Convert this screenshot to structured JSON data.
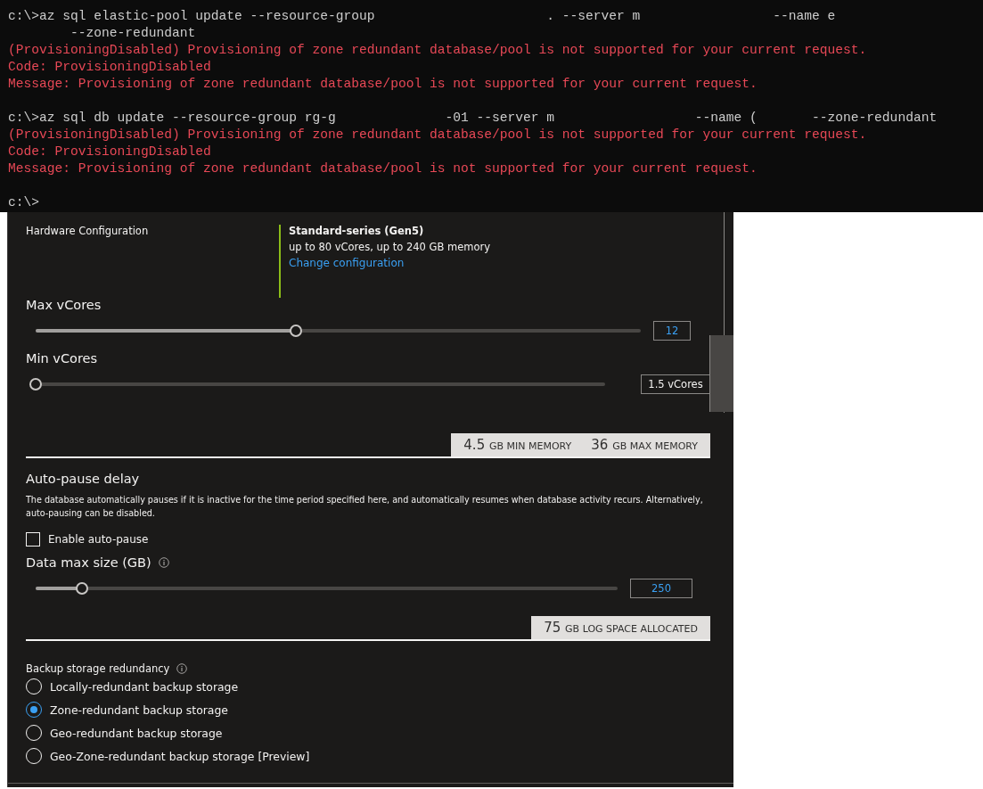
{
  "terminal": {
    "lines": [
      {
        "kind": "command",
        "text": "c:\\>az sql elastic-pool update --resource-group                      . --server m                 --name e"
      },
      {
        "kind": "command",
        "text": "        --zone-redundant"
      },
      {
        "kind": "error",
        "text": "(ProvisioningDisabled) Provisioning of zone redundant database/pool is not supported for your current request."
      },
      {
        "kind": "error",
        "text": "Code: ProvisioningDisabled"
      },
      {
        "kind": "error",
        "text": "Message: Provisioning of zone redundant database/pool is not supported for your current request."
      },
      {
        "kind": "blank"
      },
      {
        "kind": "command",
        "text": "c:\\>az sql db update --resource-group rg-g              -01 --server m                  --name (       --zone-redundant"
      },
      {
        "kind": "error",
        "text": "(ProvisioningDisabled) Provisioning of zone redundant database/pool is not supported for your current request."
      },
      {
        "kind": "error",
        "text": "Code: ProvisioningDisabled"
      },
      {
        "kind": "error",
        "text": "Message: Provisioning of zone redundant database/pool is not supported for your current request."
      },
      {
        "kind": "blank"
      },
      {
        "kind": "command",
        "text": "c:\\>"
      }
    ]
  },
  "hardware": {
    "label": "Hardware Configuration",
    "series": "Standard-series (Gen5)",
    "details": "up to 80 vCores, up to 240 GB memory",
    "link": "Change configuration"
  },
  "max_vcores": {
    "label": "Max vCores",
    "level": 0.43,
    "value": "12"
  },
  "min_vcores": {
    "label": "Min vCores",
    "level": 0,
    "value": "1.5 vCores"
  },
  "memory": [
    {
      "amount": "4.5",
      "unit": "GB MIN MEMORY"
    },
    {
      "amount": "36",
      "unit": "GB MAX MEMORY"
    }
  ],
  "auto_pause": {
    "title": "Auto-pause delay",
    "description": "The database automatically pauses if it is inactive for the time period specified here, and automatically resumes when database activity recurs. Alternatively, auto-pausing can be disabled.",
    "checkbox": {
      "label": "Enable auto-pause",
      "checked": false
    }
  },
  "data_max_size": {
    "label": "Data max size (GB)",
    "level": 0.08,
    "value": "250"
  },
  "log_space": [
    {
      "amount": "75",
      "unit": "GB LOG SPACE ALLOCATED"
    }
  ],
  "backup": {
    "label": "Backup storage redundancy",
    "options": [
      {
        "label": "Locally-redundant backup storage",
        "selected": false
      },
      {
        "label": "Zone-redundant backup storage",
        "selected": true
      },
      {
        "label": "Geo-redundant backup storage",
        "selected": false
      },
      {
        "label": "Geo-Zone-redundant backup storage [Preview]",
        "selected": false
      }
    ]
  }
}
